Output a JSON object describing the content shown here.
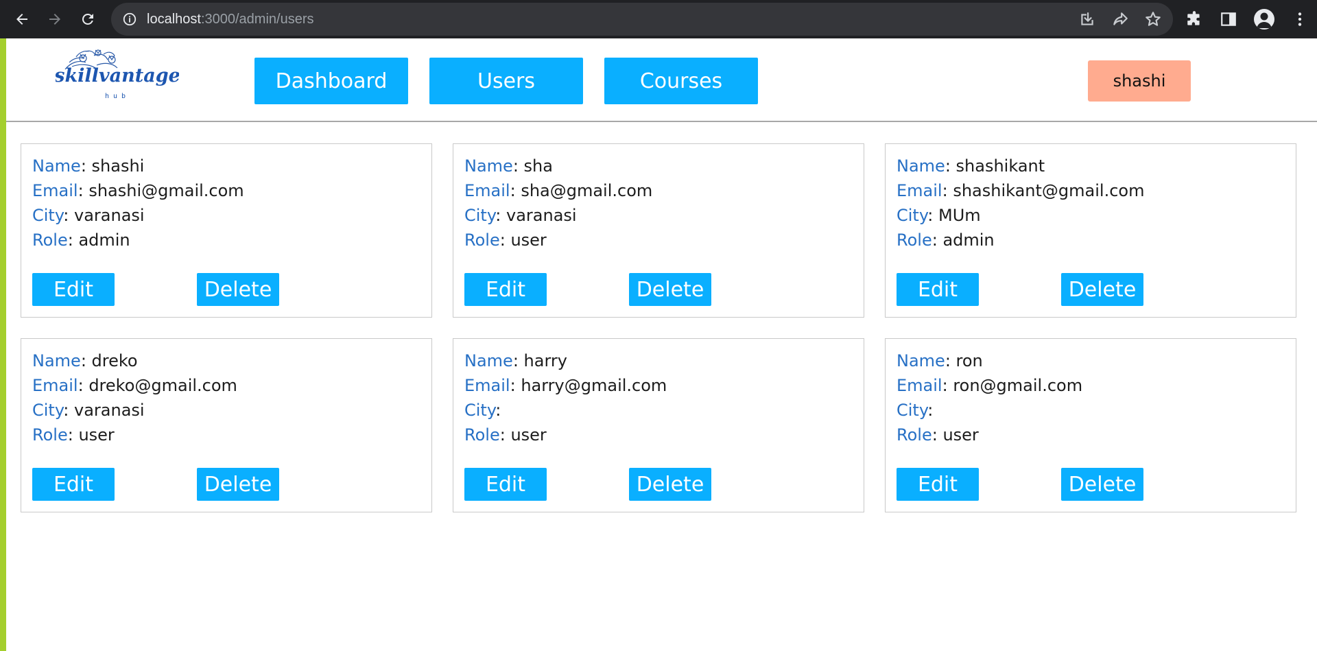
{
  "browser": {
    "url_host": "localhost",
    "url_path": ":3000/admin/users"
  },
  "header": {
    "logo_text": "skillvantage",
    "logo_sub": "hub",
    "nav": [
      "Dashboard",
      "Users",
      "Courses"
    ],
    "current_user": "shashi"
  },
  "labels": {
    "name": "Name",
    "email": "Email",
    "city": "City",
    "role": "Role",
    "sep": ": ",
    "edit": "Edit",
    "delete": "Delete"
  },
  "users": [
    {
      "name": "shashi",
      "email": "shashi@gmail.com",
      "city": "varanasi",
      "role": "admin"
    },
    {
      "name": "sha",
      "email": "sha@gmail.com",
      "city": "varanasi",
      "role": "user"
    },
    {
      "name": "shashikant",
      "email": "shashikant@gmail.com",
      "city": "MUm",
      "role": "admin"
    },
    {
      "name": "dreko",
      "email": "dreko@gmail.com",
      "city": "varanasi",
      "role": "user"
    },
    {
      "name": "harry",
      "email": "harry@gmail.com",
      "city": "",
      "role": "user"
    },
    {
      "name": "ron",
      "email": "ron@gmail.com",
      "city": "",
      "role": "user"
    }
  ],
  "colors": {
    "accent": "#0aafff",
    "label": "#2770c5",
    "user_chip": "#ffab8f",
    "frame": "#a4cf2e"
  },
  "icons": [
    "back-arrow-icon",
    "forward-arrow-icon",
    "reload-icon",
    "info-icon",
    "install-icon",
    "share-icon",
    "star-icon",
    "extensions-icon",
    "side-panel-icon",
    "profile-icon",
    "menu-icon"
  ]
}
